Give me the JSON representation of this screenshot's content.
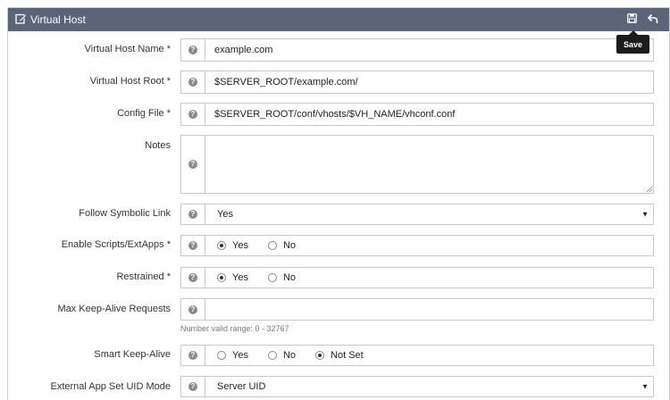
{
  "header": {
    "title": "Virtual Host",
    "title_icon": "edit-icon",
    "save_icon": "save-icon",
    "undo_icon": "undo-icon",
    "save_tooltip": "Save",
    "background": "#5b6478"
  },
  "form": {
    "vh_name": {
      "label": "Virtual Host Name *",
      "value": "example.com"
    },
    "vh_root": {
      "label": "Virtual Host Root *",
      "value": "$SERVER_ROOT/example.com/"
    },
    "config_file": {
      "label": "Config File *",
      "value": "$SERVER_ROOT/conf/vhosts/$VH_NAME/vhconf.conf"
    },
    "notes": {
      "label": "Notes",
      "value": ""
    },
    "follow_symlink": {
      "label": "Follow Symbolic Link",
      "selected": "Yes"
    },
    "enable_scripts": {
      "label": "Enable Scripts/ExtApps *",
      "options": [
        "Yes",
        "No"
      ],
      "selected": "Yes"
    },
    "restrained": {
      "label": "Restrained *",
      "options": [
        "Yes",
        "No"
      ],
      "selected": "Yes"
    },
    "max_keepalive": {
      "label": "Max Keep-Alive Requests",
      "value": "",
      "hint": "Number valid range: 0 - 32767"
    },
    "smart_keepalive": {
      "label": "Smart Keep-Alive",
      "options": [
        "Yes",
        "No",
        "Not Set"
      ],
      "selected": "Not Set"
    },
    "uid_mode": {
      "label": "External App Set UID Mode",
      "selected": "Server UID"
    }
  }
}
